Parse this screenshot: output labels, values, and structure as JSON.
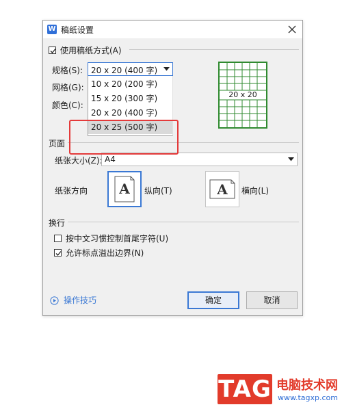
{
  "dialog": {
    "title": "稿纸设置",
    "app_icon_letter": "W"
  },
  "use_manuscript": {
    "label": "使用稿纸方式(A)",
    "checked": true
  },
  "labels": {
    "size": "规格(S):",
    "grid": "网格(G):",
    "color": "颜色(C):"
  },
  "size_select": {
    "value": "20 x 20 (400 字)",
    "options": [
      "10 x 20 (200 字)",
      "15 x 20 (300 字)",
      "20 x 20 (400 字)",
      "20 x 25 (500 字)"
    ],
    "highlighted_index": 3
  },
  "preview": {
    "label": "20 x 20",
    "color": "#2f8a2f"
  },
  "page_section": {
    "title": "页面",
    "paper_size_label": "纸张大小(Z):",
    "paper_size_value": "A4",
    "orientation_label": "纸张方向",
    "portrait_label": "纵向(T)",
    "landscape_label": "横向(L)",
    "tile_glyph": "A"
  },
  "wrap_section": {
    "title": "换行",
    "option1": {
      "label": "按中文习惯控制首尾字符(U)",
      "checked": false
    },
    "option2": {
      "label": "允许标点溢出边界(N)",
      "checked": true
    }
  },
  "footer": {
    "tips": "操作技巧",
    "ok": "确定",
    "cancel": "取消"
  },
  "watermark": {
    "tag": "TAG",
    "title": "电脑技术网",
    "url": "www.tagxp.com"
  },
  "colors": {
    "accent": "#3a78d4",
    "highlight_box": "#e43a3a",
    "preview_green": "#2f8a2f",
    "tag_red": "#e23b2b"
  }
}
